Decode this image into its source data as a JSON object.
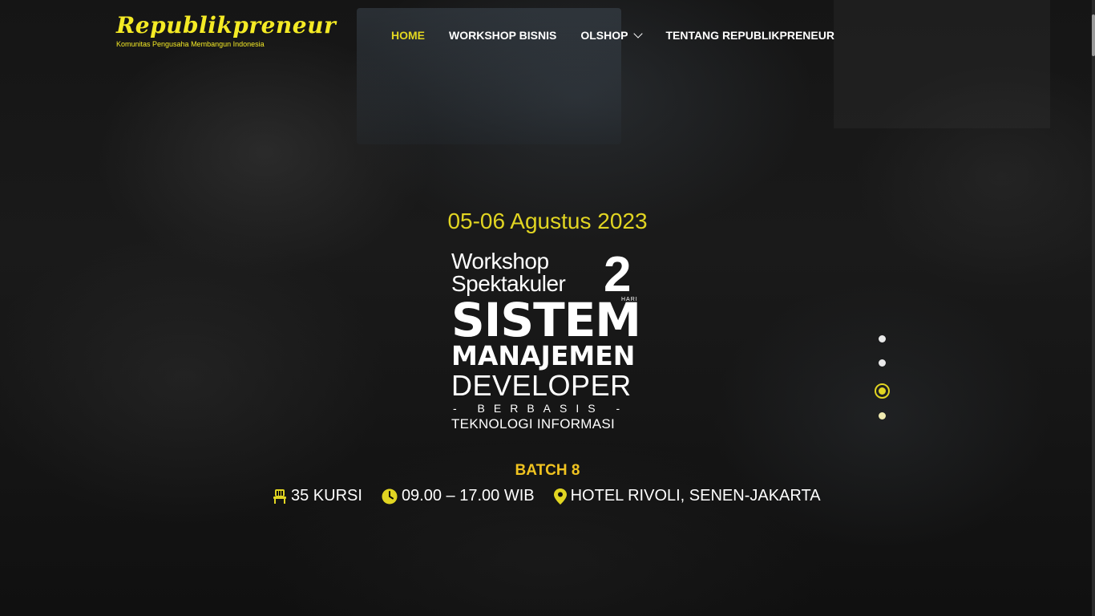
{
  "logo": {
    "title": "Republikpreneur",
    "subtitle": "Komunitas Pengusaha Membangun Indonesia"
  },
  "nav": {
    "items": [
      {
        "label": "HOME",
        "active": true
      },
      {
        "label": "WORKSHOP BISNIS",
        "active": false
      },
      {
        "label": "OLSHOP",
        "active": false,
        "has_dropdown": true
      },
      {
        "label": "TENTANG REPUBLIKPRENEUR",
        "active": false
      }
    ]
  },
  "hero": {
    "date": "05-06 Agustus 2023",
    "title": {
      "line1": "Workshop",
      "line2": "Spektakuler",
      "days": "2",
      "days_unit": "HARI",
      "main1": "SISTEM",
      "main2": "MANAJEMEN",
      "main3": "DEVELOPER",
      "connector": "- BERBASIS -",
      "tail": "TEKNOLOGI INFORMASI"
    },
    "batch": "BATCH 8",
    "info": {
      "seats": "35 KURSI",
      "time": "09.00 – 17.00 WIB",
      "location": "HOTEL RIVOLI, SENEN-JAKARTA"
    },
    "slider": {
      "count": 4,
      "active_index": 3
    }
  },
  "colors": {
    "accent": "#e1d522",
    "logo": "#f4ea25",
    "batch": "#f0c320"
  },
  "icons": [
    "chair-icon",
    "clock-icon",
    "location-pin-icon",
    "chevron-down-icon"
  ]
}
